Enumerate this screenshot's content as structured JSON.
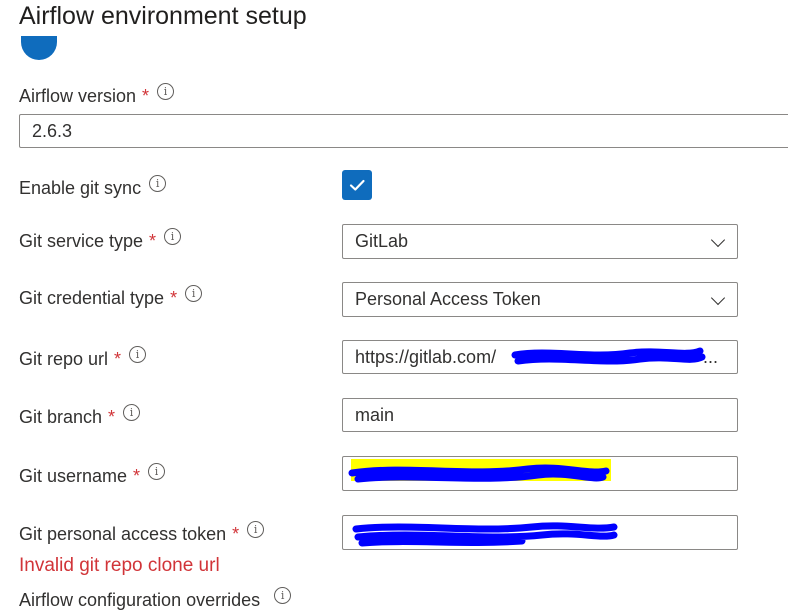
{
  "page": {
    "title": "Airflow environment setup"
  },
  "fields": {
    "airflow_version": {
      "label": "Airflow version",
      "value": "2.6.3"
    },
    "enable_git_sync": {
      "label": "Enable git sync",
      "checked": true
    },
    "git_service_type": {
      "label": "Git service type",
      "value": "GitLab"
    },
    "git_credential_type": {
      "label": "Git credential type",
      "value": "Personal Access Token"
    },
    "git_repo_url": {
      "label": "Git repo url",
      "value": "https://gitlab.com/"
    },
    "git_branch": {
      "label": "Git branch",
      "value": "main"
    },
    "git_username": {
      "label": "Git username",
      "value": ""
    },
    "git_token": {
      "label": "Git personal access token",
      "value": ""
    },
    "airflow_config_overrides": {
      "label": "Airflow configuration overrides"
    }
  },
  "errors": {
    "git_repo": "Invalid git repo clone url"
  },
  "symbols": {
    "required": "*",
    "info": "i",
    "ellipsis": "..."
  },
  "colors": {
    "accent": "#0f6cbd",
    "error": "#d13438",
    "redaction_blue": "#0000ff",
    "highlight_yellow": "#ffff00"
  },
  "icons": {
    "info": "info-icon",
    "dropdown": "chevron-down-icon",
    "check": "checkmark-icon"
  }
}
